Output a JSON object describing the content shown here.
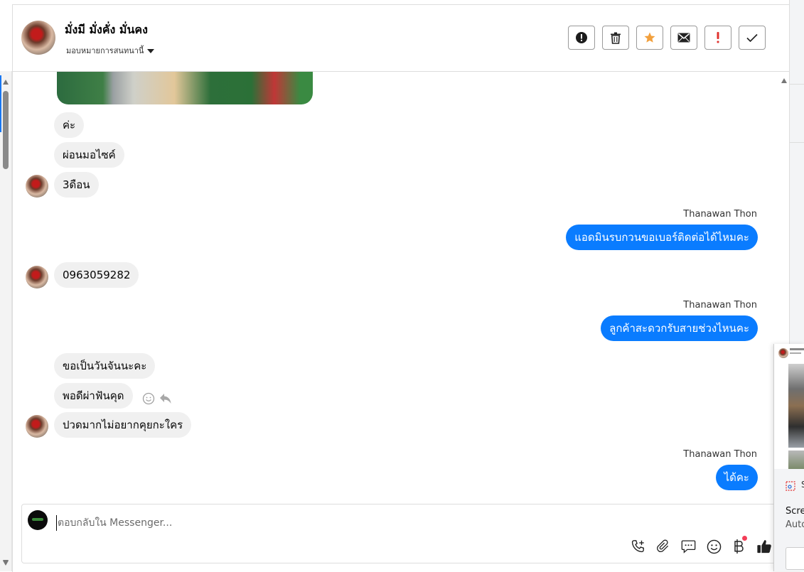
{
  "header": {
    "contact_name": "มั่งมี มั่งคั่ง มั่นคง",
    "assign_label": "มอบหมายการสนทนานี้"
  },
  "messages": {
    "m1": "ค่ะ",
    "m2": "ผ่อนมอไซค์",
    "m3": "3ดือน",
    "sender1": "Thanawan Thon",
    "o1": "แอดมินรบกวนขอเบอร์ติดต่อได้ไหมคะ",
    "m4": "0963059282",
    "sender2": "Thanawan Thon",
    "o2": "ลูกค้าสะดวกรับสายช่วงไหนคะ",
    "m5": "ขอเป็นวันจันนะคะ",
    "m6": "พอดีผ่าฟันคุด",
    "m7": "ปวดมากไม่อยากคุยกะใคร",
    "sender3": "Thanawan Thon",
    "o3": "ได้คะ"
  },
  "composer": {
    "placeholder": "ตอบกลับใน Messenger..."
  },
  "popup": {
    "line1": "Scre",
    "line2": "Auto",
    "badge": "S"
  },
  "colors": {
    "accent": "#0a7cff",
    "star": "#f2a03d",
    "alert": "#e0332f"
  }
}
